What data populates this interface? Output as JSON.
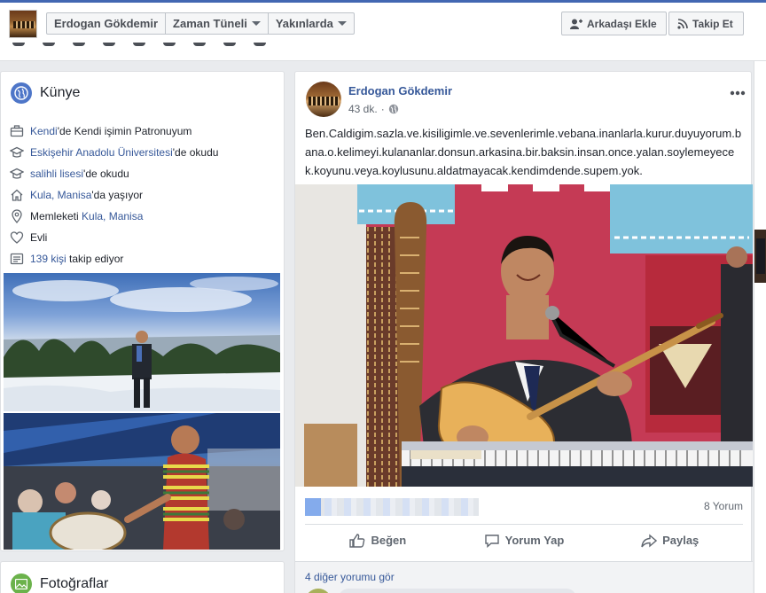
{
  "header": {
    "profile_name": "Erdogan Gökdemir",
    "nav": [
      {
        "label": "Erdogan Gökdemir",
        "dropdown": false
      },
      {
        "label": "Zaman Tüneli",
        "dropdown": true
      },
      {
        "label": "Yakınlarda",
        "dropdown": true
      }
    ],
    "add_friend_label": "Arkadaşı Ekle",
    "follow_label": "Takip Et"
  },
  "intro": {
    "title": "Künye",
    "items": [
      {
        "icon": "briefcase-icon",
        "link": "Kendi",
        "text": "'de Kendi işimin Patronuyum"
      },
      {
        "icon": "graduation-cap-icon",
        "link": "Eskişehir Anadolu Üniversitesi",
        "text": "'de okudu"
      },
      {
        "icon": "graduation-cap-icon",
        "link": "salihli lisesi",
        "text": "'de okudu"
      },
      {
        "icon": "home-icon",
        "link": "Kula, Manisa",
        "text": "'da yaşıyor"
      },
      {
        "icon": "location-pin-icon",
        "link": "Kula, Manisa",
        "text": "Memleketi "
      },
      {
        "icon": "heart-icon",
        "link": "",
        "text": "Evli"
      },
      {
        "icon": "followers-icon",
        "link": "139 kişi",
        "text": " takip ediyor"
      }
    ]
  },
  "photos_section": {
    "title": "Fotoğraflar"
  },
  "post": {
    "author": "Erdogan Gökdemir",
    "time": "43 dk.",
    "privacy_icon": "globe-icon",
    "text": "Ben.Caldigim.sazla.ve.kisiligimle.ve.sevenlerimle.vebana.inanlarla.kurur.duyuyorum.bana.o.kelimeyi.kulananlar.donsun.arkasina.bir.baksin.insan.once.yalan.soylemeyecek.koyunu.veya.koylusunu.aldatmayacak.kendimdende.supem.yok.",
    "comment_count": "8 Yorum",
    "actions": {
      "like": "Beğen",
      "comment": "Yorum Yap",
      "share": "Paylaş"
    },
    "more_comments": "4 diğer yorumu gör"
  },
  "colors": {
    "link": "#365899",
    "brand": "#4267b2",
    "text": "#1d2129",
    "muted": "#606770"
  }
}
